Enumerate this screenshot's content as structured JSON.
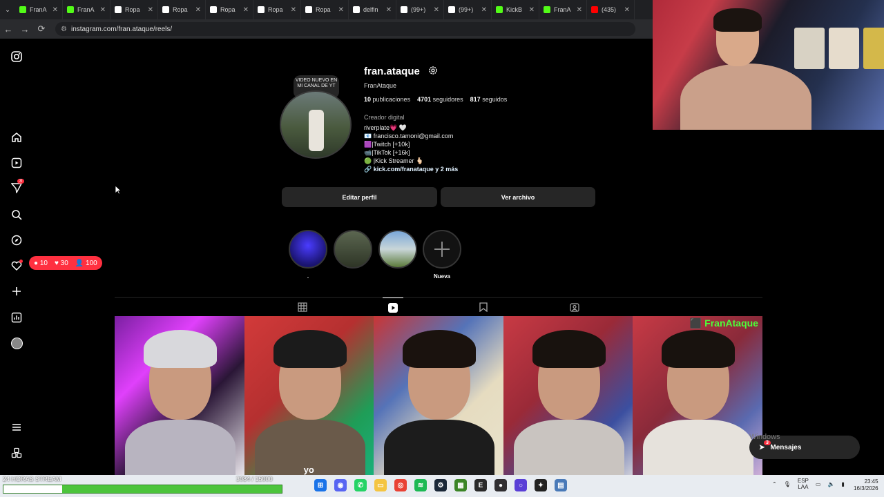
{
  "browser": {
    "tabs": [
      {
        "label": "FranA",
        "icon": "kick-icon",
        "color": "#53fc18"
      },
      {
        "label": "FranA",
        "icon": "kick-icon",
        "color": "#53fc18"
      },
      {
        "label": "Ropa",
        "icon": "s-icon",
        "color": "#ffffff"
      },
      {
        "label": "Ropa",
        "icon": "s-icon",
        "color": "#ffffff"
      },
      {
        "label": "Ropa",
        "icon": "s-icon",
        "color": "#ffffff"
      },
      {
        "label": "Ropa",
        "icon": "s-icon",
        "color": "#ffffff"
      },
      {
        "label": "Ropa",
        "icon": "s-icon",
        "color": "#ffffff"
      },
      {
        "label": "delfin",
        "icon": "tiktok-icon",
        "color": "#ffffff"
      },
      {
        "label": "(99+)",
        "icon": "tiktok-icon",
        "color": "#ffffff"
      },
      {
        "label": "(99+)",
        "icon": "tiktok-icon",
        "color": "#ffffff"
      },
      {
        "label": "KickB",
        "icon": "kick-icon",
        "color": "#53fc18"
      },
      {
        "label": "FranA",
        "icon": "kick-icon",
        "color": "#53fc18"
      },
      {
        "label": "(435)",
        "icon": "youtube-icon",
        "color": "#ff0000"
      }
    ],
    "url": "instagram.com/fran.ataque/reels/"
  },
  "profile": {
    "username": "fran.ataque",
    "full_name": "FranAtaque",
    "note": "VIDEO NUEVO EN MI CANAL DE YT",
    "stats": {
      "posts_num": "10",
      "posts_label": "publicaciones",
      "followers_num": "4701",
      "followers_label": "seguidores",
      "following_num": "817",
      "following_label": "seguidos"
    },
    "category": "Creador digital",
    "bio": [
      "riverplate💗 🤍",
      "📧 francisco.tamoni@gmail.com",
      "🟪|Twitch [+10k]",
      "📹|TikTok [+16k]",
      "🟢 |Kick Streamer 🫰🏻"
    ],
    "link": "kick.com/franataque y 2 más",
    "edit_button": "Editar perfil",
    "archive_button": "Ver archivo",
    "highlights": [
      {
        "label": "."
      },
      {
        "label": ""
      },
      {
        "label": ""
      },
      {
        "label": "Nueva"
      }
    ]
  },
  "notifications": {
    "comments": "10",
    "likes": "30",
    "follows": "100",
    "messages_badge": "3"
  },
  "grid_overlays": {
    "tile5_name": "FranAtaque",
    "tile2_caption": "yo"
  },
  "messages": {
    "label": "Mensajes",
    "badge": "3",
    "watermark": "Windows"
  },
  "stream": {
    "label": "24 HORAS STREAM",
    "count": "3084 / 15000",
    "progress": 0.21
  },
  "system": {
    "lang_top": "ESP",
    "lang_bottom": "LAA",
    "time": "23:45",
    "date": "16/3/2026"
  }
}
